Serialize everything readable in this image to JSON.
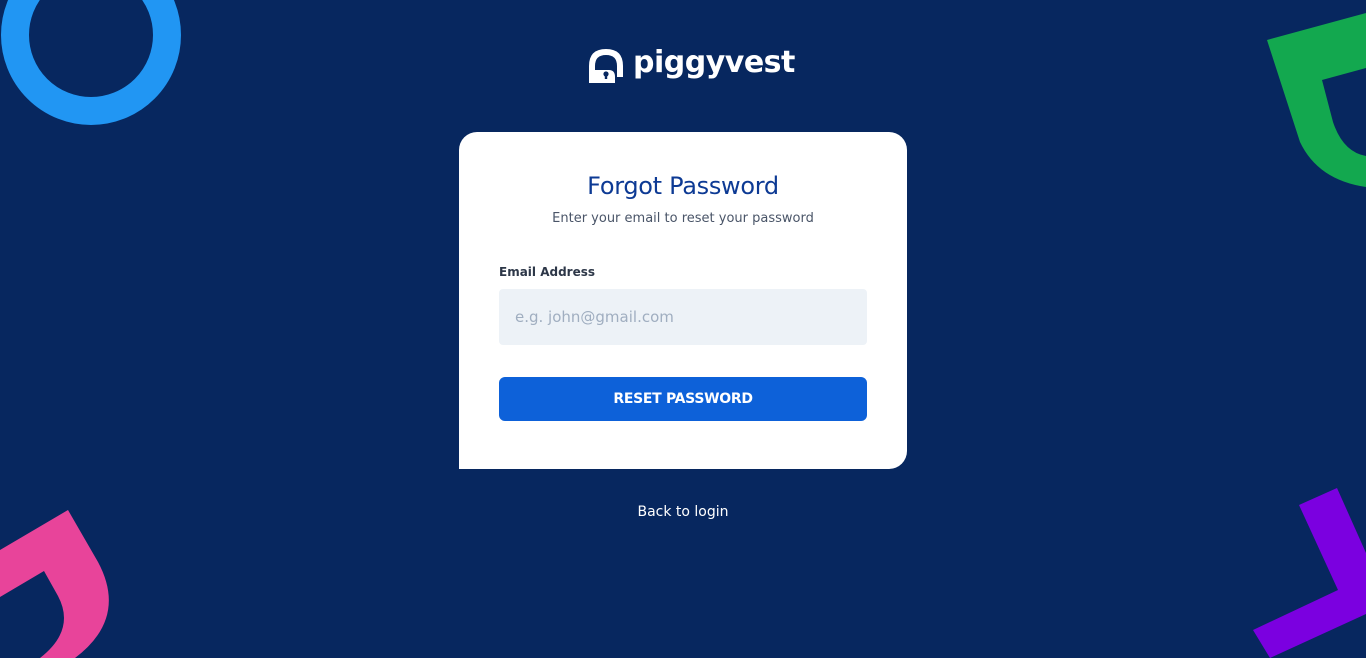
{
  "brand": {
    "name": "piggyvest",
    "icon": "piggyvest-lock-icon"
  },
  "card": {
    "title": "Forgot Password",
    "subtitle": "Enter your email to reset your password"
  },
  "form": {
    "email_label": "Email Address",
    "email_value": "",
    "email_placeholder": "e.g. john@gmail.com",
    "submit_label": "RESET PASSWORD"
  },
  "footer": {
    "back_link": "Back to login"
  },
  "colors": {
    "background": "#07275f",
    "primary_button": "#0d61d9",
    "title": "#0d3a94",
    "decor_ring": "#2196f3",
    "decor_green": "#13a84f",
    "decor_pink": "#e8449a",
    "decor_purple": "#7b00e0"
  }
}
